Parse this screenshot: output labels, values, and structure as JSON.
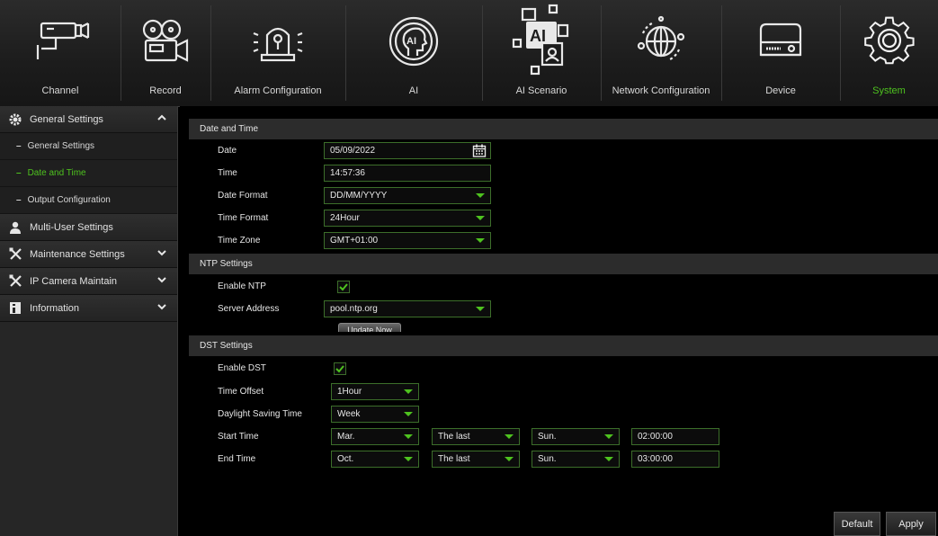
{
  "topnav": {
    "items": [
      {
        "label": "Channel",
        "icon": "camera-icon"
      },
      {
        "label": "Record",
        "icon": "film-camera-icon"
      },
      {
        "label": "Alarm Configuration",
        "icon": "alarm-siren-icon"
      },
      {
        "label": "AI",
        "icon": "ai-head-icon"
      },
      {
        "label": "AI Scenario",
        "icon": "ai-scenario-icon"
      },
      {
        "label": "Network Configuration",
        "icon": "globe-network-icon"
      },
      {
        "label": "Device",
        "icon": "storage-device-icon"
      },
      {
        "label": "System",
        "icon": "gear-icon"
      }
    ],
    "active": "System"
  },
  "sidebar": {
    "groups": [
      {
        "label": "General Settings",
        "icon": "gear-icon",
        "expanded": true,
        "items": [
          {
            "label": "General Settings"
          },
          {
            "label": "Date and Time",
            "active": true
          },
          {
            "label": "Output Configuration"
          }
        ]
      },
      {
        "label": "Multi-User Settings",
        "icon": "user-icon"
      },
      {
        "label": "Maintenance Settings",
        "icon": "tools-icon",
        "expanded": false
      },
      {
        "label": "IP Camera Maintain",
        "icon": "tools-icon",
        "expanded": false
      },
      {
        "label": "Information",
        "icon": "info-icon",
        "expanded": false
      }
    ],
    "dash": "–"
  },
  "date_time": {
    "title": "Date and Time",
    "date": {
      "label": "Date",
      "value": "05/09/2022"
    },
    "time": {
      "label": "Time",
      "value": "14:57:36"
    },
    "date_format": {
      "label": "Date Format",
      "value": "DD/MM/YYYY"
    },
    "time_format": {
      "label": "Time Format",
      "value": "24Hour"
    },
    "time_zone": {
      "label": "Time Zone",
      "value": "GMT+01:00"
    }
  },
  "ntp": {
    "title": "NTP Settings",
    "enable": {
      "label": "Enable NTP",
      "checked": true
    },
    "server": {
      "label": "Server Address",
      "value": "pool.ntp.org"
    },
    "update_button": "Update Now"
  },
  "dst": {
    "title": "DST Settings",
    "enable": {
      "label": "Enable DST",
      "checked": true
    },
    "offset": {
      "label": "Time Offset",
      "value": "1Hour"
    },
    "mode": {
      "label": "Daylight Saving Time",
      "value": "Week"
    },
    "start": {
      "label": "Start Time",
      "month": "Mar.",
      "week": "The last",
      "day": "Sun.",
      "time": "02:00:00"
    },
    "end": {
      "label": "End Time",
      "month": "Oct.",
      "week": "The last",
      "day": "Sun.",
      "time": "03:00:00"
    }
  },
  "footer": {
    "default_button": "Default",
    "apply_button": "Apply"
  },
  "colors": {
    "accent": "#4ec21f",
    "section_bg": "#2c2c2c",
    "sidebar_bg": "#262626"
  }
}
